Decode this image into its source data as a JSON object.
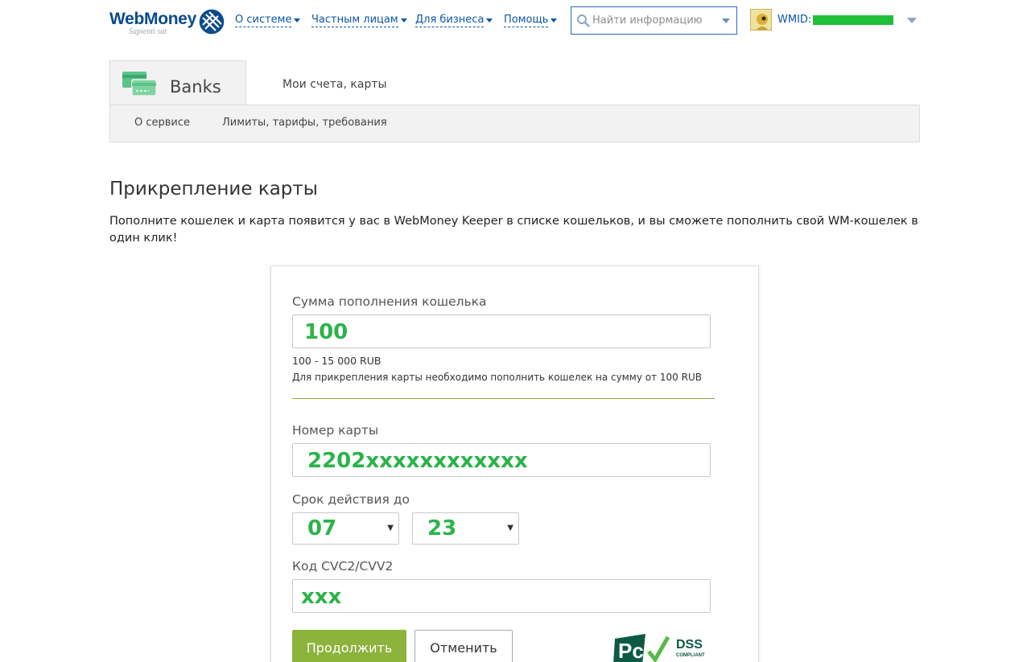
{
  "header": {
    "logo_text": "WebMoney",
    "logo_sub": "Sapienti sat",
    "nav": [
      {
        "label": "О системе"
      },
      {
        "label": "Частным лицам"
      },
      {
        "label": "Для бизнеса"
      },
      {
        "label": "Помощь"
      }
    ],
    "search_placeholder": "Найти информацию",
    "wmid_label": "WMID:",
    "wmid_value": "--- ---- ------"
  },
  "service": {
    "title": "Banks",
    "tabs": [
      {
        "label": "Мои счета, карты"
      }
    ],
    "subnav": [
      {
        "label": "О сервисе"
      },
      {
        "label": "Лимиты, тарифы, требования"
      }
    ]
  },
  "main": {
    "title": "Прикрепление карты",
    "intro": "Пополните кошелек и карта появится у вас в WebMoney Keeper в списке кошельков, и вы сможете пополнить свой WM-кошелек в один клик!"
  },
  "form": {
    "amount_label": "Сумма пополнения кошелька",
    "amount_value": "100",
    "amount_range": "100 - 15 000 RUB",
    "amount_hint": "Для прикрепления карты необходимо пополнить кошелек на сумму от 100 RUB",
    "card_label": "Номер карты",
    "card_value": "2202xxxxxxxxxxxx",
    "expiry_label": "Срок действия до",
    "expiry_month": "07",
    "expiry_year": "23",
    "cvc_label": "Код CVC2/CVV2",
    "cvc_value": "xxx",
    "continue_label": "Продолжить",
    "cancel_label": "Отменить",
    "pci_text": "DSS",
    "pci_sub": "COMPLIANT"
  },
  "colors": {
    "brand_blue": "#0a57a4",
    "accent_green": "#8cb33b",
    "value_green": "#2bb34a",
    "banks_icon": "#5cc48a"
  },
  "icons": {
    "search": "search-icon",
    "globe": "webmoney-globe-icon",
    "banks": "banks-cards-icon"
  }
}
